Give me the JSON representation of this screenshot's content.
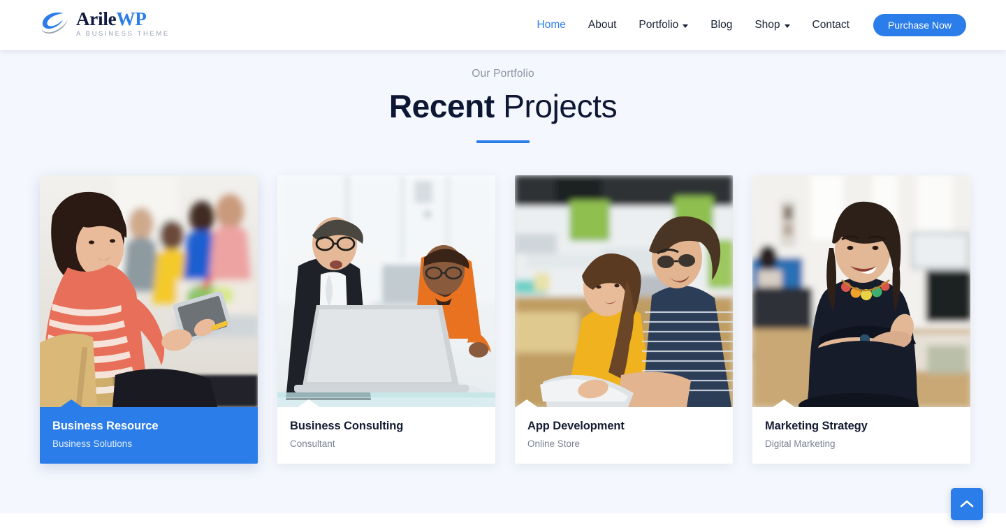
{
  "header": {
    "logo": {
      "icon": "globe-swoosh-icon",
      "name_primary": "Arile",
      "name_secondary": "WP",
      "tagline": "A BUSINESS THEME"
    },
    "nav": [
      {
        "label": "Home",
        "active": true,
        "has_dropdown": false,
        "name": "nav-item-home"
      },
      {
        "label": "About",
        "active": false,
        "has_dropdown": false,
        "name": "nav-item-about"
      },
      {
        "label": "Portfolio",
        "active": false,
        "has_dropdown": true,
        "name": "nav-item-portfolio"
      },
      {
        "label": "Blog",
        "active": false,
        "has_dropdown": false,
        "name": "nav-item-blog"
      },
      {
        "label": "Shop",
        "active": false,
        "has_dropdown": true,
        "name": "nav-item-shop"
      },
      {
        "label": "Contact",
        "active": false,
        "has_dropdown": false,
        "name": "nav-item-contact"
      }
    ],
    "cta_label": "Purchase Now"
  },
  "portfolio": {
    "eyebrow": "Our Portfolio",
    "title_strong": "Recent",
    "title_light": "Projects",
    "cards": [
      {
        "title": "Business Resource",
        "category": "Business Solutions",
        "active": true,
        "image_alt": "Woman in red striped top holding a tablet with colleagues blurred behind her"
      },
      {
        "title": "Business Consulting",
        "category": "Consultant",
        "active": false,
        "image_alt": "Two businessmen reviewing a laptop in a bright glass office"
      },
      {
        "title": "App Development",
        "category": "Online Store",
        "active": false,
        "image_alt": "Young woman in yellow tee and man in striped tee holding a tablet in an open office"
      },
      {
        "title": "Marketing Strategy",
        "category": "Digital Marketing",
        "active": false,
        "image_alt": "Smiling woman in a navy dress with arms crossed in an open-plan office"
      }
    ]
  },
  "back_to_top": {
    "icon": "chevron-up-icon",
    "label": "Back to top"
  },
  "colors": {
    "accent": "#2b7de9",
    "section_bg": "#f4f7fd",
    "heading": "#0d1733",
    "muted_text": "#8d93a3",
    "card_bg": "#ffffff"
  }
}
